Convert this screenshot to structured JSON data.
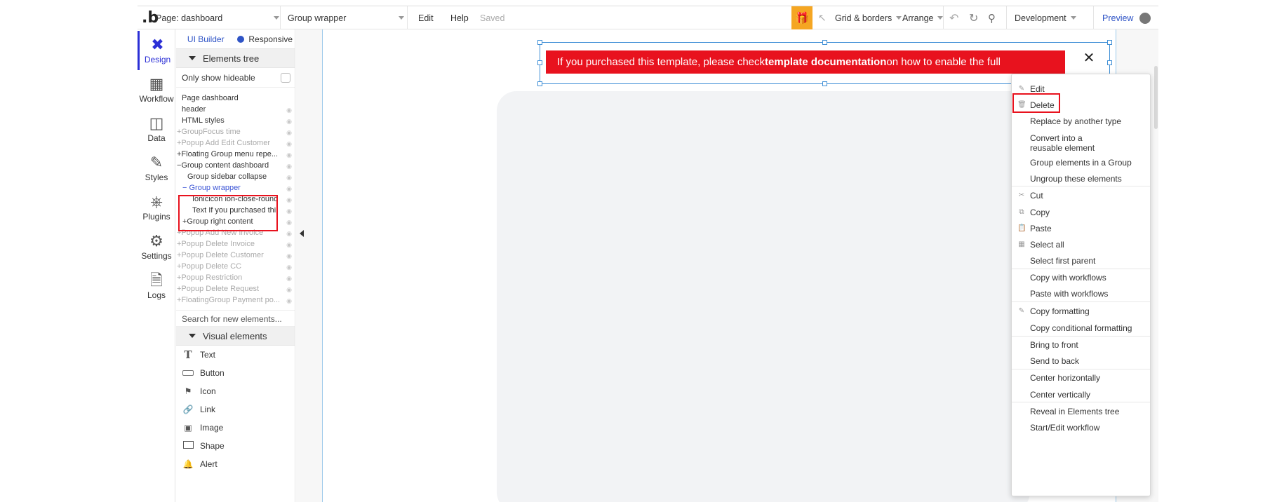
{
  "topbar": {
    "logo": ".b",
    "page_selector": "Page: dashboard",
    "element_selector": "Group wrapper",
    "edit": "Edit",
    "help": "Help",
    "saved": "Saved",
    "gift_icon": "gift-icon",
    "grid_borders": "Grid & borders",
    "arrange": "Arrange",
    "development": "Development",
    "preview": "Preview"
  },
  "rail": [
    {
      "label": "Design",
      "icon": "design-icon"
    },
    {
      "label": "Workflow",
      "icon": "workflow-icon"
    },
    {
      "label": "Data",
      "icon": "data-icon"
    },
    {
      "label": "Styles",
      "icon": "styles-icon"
    },
    {
      "label": "Plugins",
      "icon": "plugins-icon"
    },
    {
      "label": "Settings",
      "icon": "settings-icon"
    },
    {
      "label": "Logs",
      "icon": "logs-icon"
    }
  ],
  "panel": {
    "tab_ui_builder": "UI Builder",
    "tab_responsive": "Responsive",
    "elements_tree": "Elements tree",
    "only_show_hideable": "Only show hideable",
    "tree": [
      {
        "label": "Page dashboard"
      },
      {
        "label": "header"
      },
      {
        "label": "HTML styles"
      },
      {
        "label": "+GroupFocus time"
      },
      {
        "label": "+Popup Add Edit Customer"
      },
      {
        "label": "+Floating Group menu repe..."
      },
      {
        "label": "−Group content dashboard"
      },
      {
        "label": "Group sidebar collapse"
      },
      {
        "label": "− Group wrapper"
      },
      {
        "label": "Ionicicon ion-close-round"
      },
      {
        "label": "Text If you purchased thi"
      },
      {
        "label": "+Group right content"
      },
      {
        "label": "+Popup Add New Invoice"
      },
      {
        "label": "+Popup Delete Invoice"
      },
      {
        "label": "+Popup Delete Customer"
      },
      {
        "label": "+Popup Delete CC"
      },
      {
        "label": "+Popup Restriction"
      },
      {
        "label": "+Popup Delete Request"
      },
      {
        "label": "+FloatingGroup Payment po..."
      }
    ],
    "search_placeholder": "Search for new elements...",
    "visual_elements": "Visual elements",
    "visual": [
      {
        "label": "Text",
        "icon": "text-icon"
      },
      {
        "label": "Button",
        "icon": "button-icon"
      },
      {
        "label": "Icon",
        "icon": "flag-icon"
      },
      {
        "label": "Link",
        "icon": "link-icon"
      },
      {
        "label": "Image",
        "icon": "image-icon"
      },
      {
        "label": "Shape",
        "icon": "shape-icon"
      },
      {
        "label": "Alert",
        "icon": "bell-icon"
      }
    ]
  },
  "canvas": {
    "banner_text_pre": "If you purchased this template, please check ",
    "banner_text_bold": "template documentation",
    "banner_text_post": " on how to enable the full",
    "close_icon": "close-icon"
  },
  "context_menu": [
    {
      "label": "Edit",
      "icon": "edit-icon"
    },
    {
      "label": "Delete",
      "icon": "trash-icon"
    },
    {
      "label": "Replace by another type"
    },
    {
      "label": "Convert into a reusable element"
    },
    {
      "label": "Group elements in a Group"
    },
    {
      "label": "Ungroup these elements"
    },
    {
      "label": "Cut",
      "icon": "scissors-icon"
    },
    {
      "label": "Copy",
      "icon": "copy-icon"
    },
    {
      "label": "Paste",
      "icon": "paste-icon"
    },
    {
      "label": "Select all",
      "icon": "grid-icon"
    },
    {
      "label": "Select first parent"
    },
    {
      "label": "Copy with workflows"
    },
    {
      "label": "Paste with workflows"
    },
    {
      "label": "Copy formatting",
      "icon": "eraser-icon"
    },
    {
      "label": "Copy conditional formatting"
    },
    {
      "label": "Bring to front"
    },
    {
      "label": "Send to back"
    },
    {
      "label": "Center horizontally"
    },
    {
      "label": "Center vertically"
    },
    {
      "label": "Reveal in Elements tree"
    },
    {
      "label": "Start/Edit workflow"
    }
  ],
  "colors": {
    "accent_blue": "#2b2fd6",
    "banner_red": "#e8121e",
    "highlight_red": "#e8121e",
    "gift_orange": "#f5a623"
  }
}
